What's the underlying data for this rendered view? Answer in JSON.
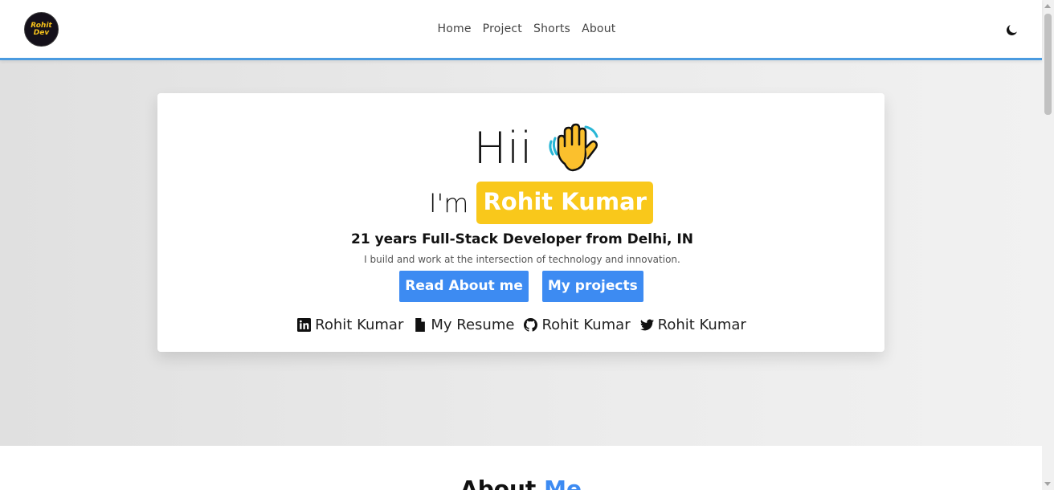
{
  "nav": {
    "logo_line1": "Rohit",
    "logo_line2": "Dev",
    "links": [
      "Home",
      "Project",
      "Shorts",
      "About"
    ],
    "theme_icon": "moon-icon"
  },
  "hero": {
    "greeting": "Hii",
    "greeting_icon": "waving-hand-emoji",
    "intro_prefix": "I'm",
    "name": "Rohit Kumar",
    "role": "21 years Full-Stack Developer from Delhi, IN",
    "tagline": "I build and work at the intersection of technology and innovation.",
    "buttons": {
      "about": "Read About me",
      "projects": "My projects"
    },
    "socials": [
      {
        "icon": "linkedin-icon",
        "label": "Rohit Kumar"
      },
      {
        "icon": "document-icon",
        "label": "My Resume"
      },
      {
        "icon": "github-icon",
        "label": "Rohit Kumar"
      },
      {
        "icon": "twitter-icon",
        "label": "Rohit Kumar"
      }
    ]
  },
  "about": {
    "heading_prefix": "About",
    "heading_accent": "Me"
  },
  "colors": {
    "accent_blue": "#3d8bf2",
    "name_badge_yellow": "#f9c81b",
    "nav_border": "#4a9be0"
  }
}
